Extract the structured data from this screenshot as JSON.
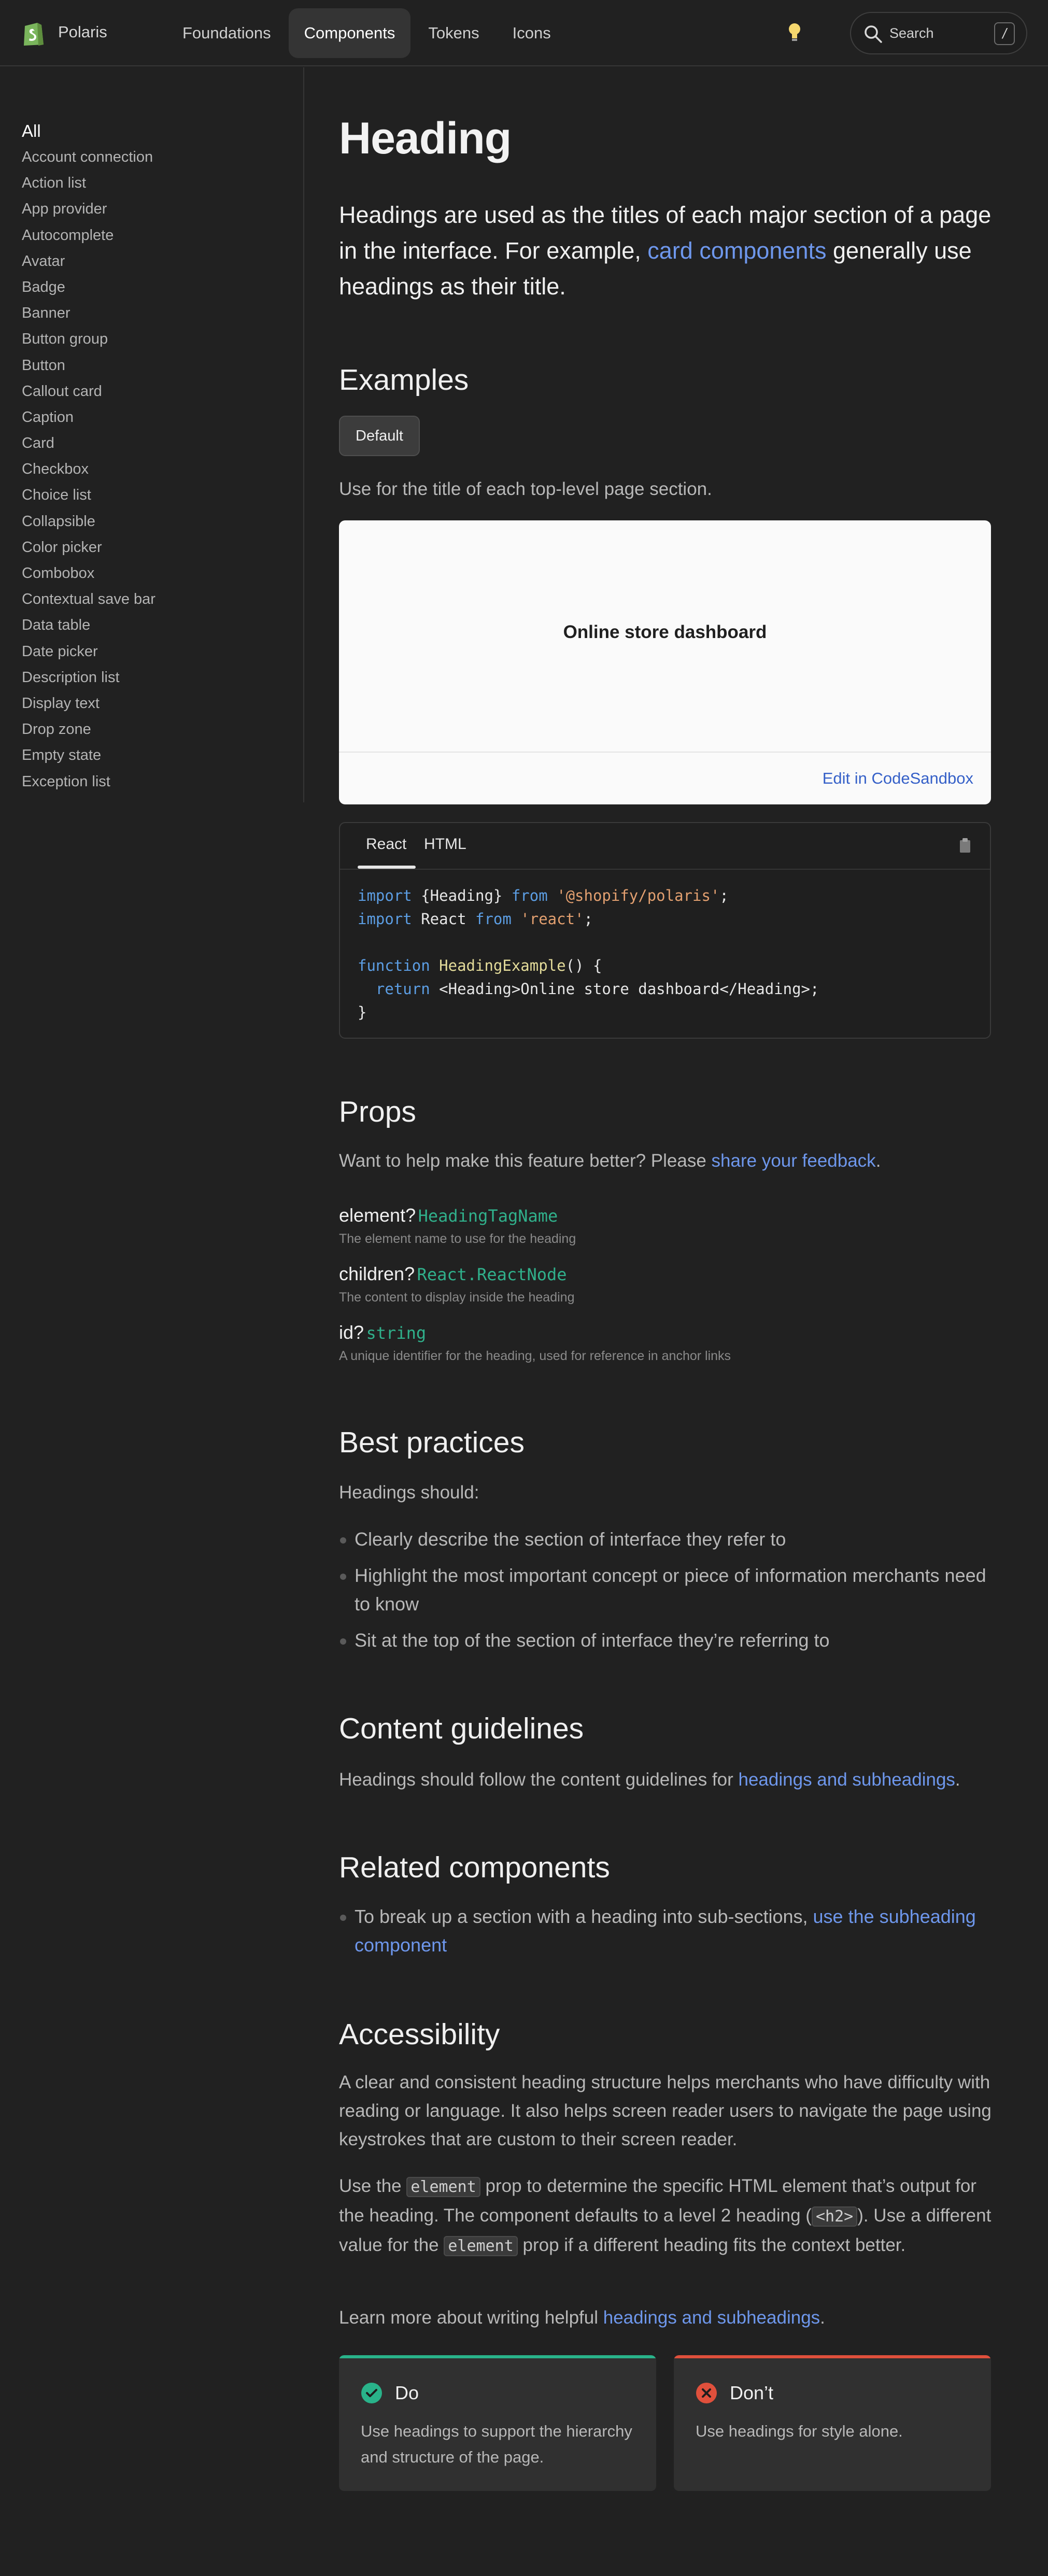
{
  "header": {
    "brand": "Polaris",
    "nav": [
      "Foundations",
      "Components",
      "Tokens",
      "Icons"
    ],
    "active_nav": "Components",
    "search_placeholder": "Search",
    "search_shortcut": "/"
  },
  "sidebar": {
    "all_label": "All",
    "items": [
      "Account connection",
      "Action list",
      "App provider",
      "Autocomplete",
      "Avatar",
      "Badge",
      "Banner",
      "Button group",
      "Button",
      "Callout card",
      "Caption",
      "Card",
      "Checkbox",
      "Choice list",
      "Collapsible",
      "Color picker",
      "Combobox",
      "Contextual save bar",
      "Data table",
      "Date picker",
      "Description list",
      "Display text",
      "Drop zone",
      "Empty state",
      "Exception list"
    ]
  },
  "page": {
    "title": "Heading",
    "lead_before": "Headings are used as the titles of each major section of a page in the interface. For example, ",
    "lead_link": "card components",
    "lead_after": " generally use headings as their title."
  },
  "examples": {
    "heading": "Examples",
    "pill_label": "Default",
    "description": "Use for the title of each top-level page section.",
    "preview_title": "Online store dashboard",
    "edit_link": "Edit in CodeSandbox"
  },
  "code": {
    "tabs": [
      "React",
      "HTML"
    ],
    "active_tab": "React",
    "lines": {
      "l1_kw1": "import",
      "l1_mid": " {Heading} ",
      "l1_kw2": "from",
      "l1_str": " '@shopify/polaris'",
      "l1_end": ";",
      "l2_kw1": "import",
      "l2_mid": " React ",
      "l2_kw2": "from",
      "l2_str": " 'react'",
      "l2_end": ";",
      "l3_kw": "function",
      "l3_fn": " HeadingExample",
      "l3_end": "() {",
      "l4_kw": "  return",
      "l4_end": " <Heading>Online store dashboard</Heading>;",
      "l5": "}"
    }
  },
  "props": {
    "heading": "Props",
    "feedback_before": "Want to help make this feature better? Please ",
    "feedback_link": "share your feedback",
    "feedback_after": ".",
    "items": [
      {
        "name": "element?",
        "type": "HeadingTagName",
        "desc": "The element name to use for the heading"
      },
      {
        "name": "children?",
        "type": "React.ReactNode",
        "desc": "The content to display inside the heading"
      },
      {
        "name": "id?",
        "type": "string",
        "desc": "A unique identifier for the heading, used for reference in anchor links"
      }
    ]
  },
  "best_practices": {
    "heading": "Best practices",
    "intro": "Headings should:",
    "bullets": [
      "Clearly describe the section of interface they refer to",
      "Highlight the most important concept or piece of information merchants need to know",
      "Sit at the top of the section of interface they’re referring to"
    ]
  },
  "content_guidelines": {
    "heading": "Content guidelines",
    "text_before": "Headings should follow the content guidelines for ",
    "link": "headings and subheadings",
    "text_after": "."
  },
  "related": {
    "heading": "Related components",
    "text_before": "To break up a section with a heading into sub-sections, ",
    "link": "use the subheading component"
  },
  "accessibility": {
    "heading": "Accessibility",
    "p1": "A clear and consistent heading structure helps merchants who have difficulty with reading or language. It also helps screen reader users to navigate the page using keystrokes that are custom to their screen reader.",
    "p2_a": "Use the ",
    "p2_code1": "element",
    "p2_b": " prop to determine the specific HTML element that’s output for the heading. The component defaults to a level 2 heading (",
    "p2_code2": "<h2>",
    "p2_c": "). Use a different value for the ",
    "p2_code3": "element",
    "p2_d": " prop if a different heading fits the context better.",
    "p3_before": "Learn more about writing helpful ",
    "p3_link": "headings and subheadings",
    "p3_after": ".",
    "do_title": "Do",
    "do_text": "Use headings to support the hierarchy and structure of the page.",
    "dont_title": "Don’t",
    "dont_text": "Use headings for style alone."
  },
  "colors": {
    "background": "#212121",
    "link": "#6e97ec",
    "do_accent": "#29b38a",
    "dont_accent": "#e0503c",
    "type_green": "#30b08b"
  }
}
